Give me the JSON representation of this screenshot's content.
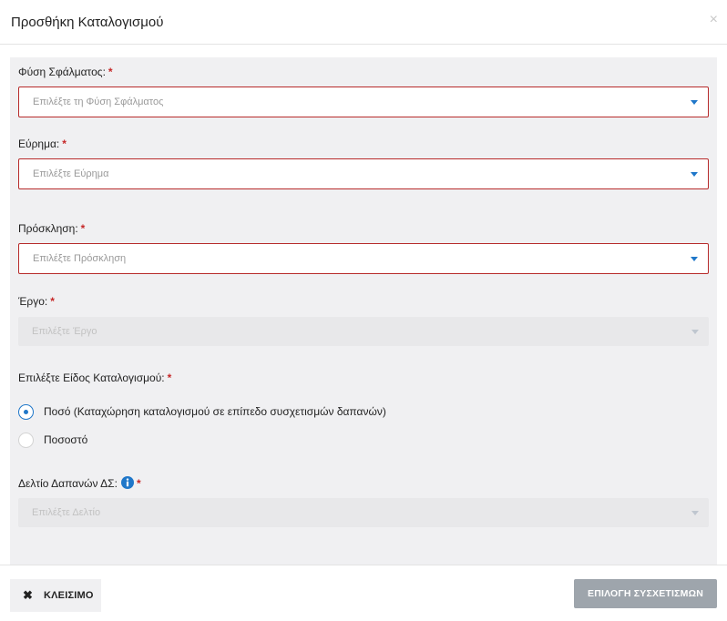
{
  "dialog": {
    "title": "Προσθήκη Καταλογισμού",
    "close_glyph": "×"
  },
  "form": {
    "required_mark": "*",
    "fault_type": {
      "label": "Φύση Σφάλματος:",
      "placeholder": "Επιλέξτε τη Φύση Σφάλματος",
      "disabled": false
    },
    "finding": {
      "label": "Εύρημα:",
      "placeholder": "Επιλέξτε Εύρημα",
      "disabled": false
    },
    "call": {
      "label": "Πρόσκληση:",
      "placeholder": "Επιλέξτε Πρόσκληση",
      "disabled": false
    },
    "project": {
      "label": "Έργο:",
      "placeholder": "Επιλέξτε Έργο",
      "disabled": true
    },
    "charge_type": {
      "label": "Επιλέξτε Είδος Καταλογισμού:",
      "options": [
        {
          "label": "Ποσό (Καταχώρηση καταλογισμού σε επίπεδο συσχετισμών δαπανών)",
          "checked": true
        },
        {
          "label": "Ποσοστό",
          "checked": false
        }
      ]
    },
    "expense_report": {
      "label": "Δελτίο Δαπανών ΔΣ:",
      "placeholder": "Επιλέξτε Δελτίο",
      "disabled": true,
      "info_icon": "info-circle-icon"
    }
  },
  "footer": {
    "close_glyph": "✖",
    "close_label": "ΚΛΕΙΣΙΜΟ",
    "select_label": "ΕΠΙΛΟΓΗ ΣΥΣΧΕΤΙΣΜΩΝ"
  },
  "colors": {
    "accent_blue": "#1f77c9",
    "required_red": "#c62828",
    "invalid_border": "#b72b2b",
    "disabled_button": "#9ea5ac",
    "form_background": "#f0f0f2"
  }
}
